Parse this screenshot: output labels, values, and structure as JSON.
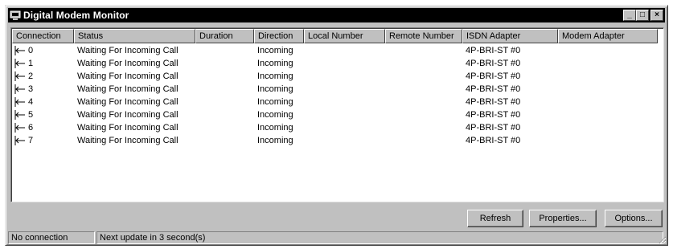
{
  "window": {
    "title": "Digital Modem Monitor",
    "controls": {
      "minimize": "_",
      "maximize": "□",
      "close": "×"
    }
  },
  "table": {
    "columns": [
      "Connection",
      "Status",
      "Duration",
      "Direction",
      "Local Number",
      "Remote Number",
      "ISDN Adapter",
      "Modem Adapter"
    ],
    "rows": [
      {
        "connection": "0",
        "status": "Waiting For Incoming Call",
        "duration": "",
        "direction": "Incoming",
        "local": "",
        "remote": "",
        "isdn": "4P-BRI-ST #0",
        "modem": ""
      },
      {
        "connection": "1",
        "status": "Waiting For Incoming Call",
        "duration": "",
        "direction": "Incoming",
        "local": "",
        "remote": "",
        "isdn": "4P-BRI-ST #0",
        "modem": ""
      },
      {
        "connection": "2",
        "status": "Waiting For Incoming Call",
        "duration": "",
        "direction": "Incoming",
        "local": "",
        "remote": "",
        "isdn": "4P-BRI-ST #0",
        "modem": ""
      },
      {
        "connection": "3",
        "status": "Waiting For Incoming Call",
        "duration": "",
        "direction": "Incoming",
        "local": "",
        "remote": "",
        "isdn": "4P-BRI-ST #0",
        "modem": ""
      },
      {
        "connection": "4",
        "status": "Waiting For Incoming Call",
        "duration": "",
        "direction": "Incoming",
        "local": "",
        "remote": "",
        "isdn": "4P-BRI-ST #0",
        "modem": ""
      },
      {
        "connection": "5",
        "status": "Waiting For Incoming Call",
        "duration": "",
        "direction": "Incoming",
        "local": "",
        "remote": "",
        "isdn": "4P-BRI-ST #0",
        "modem": ""
      },
      {
        "connection": "6",
        "status": "Waiting For Incoming Call",
        "duration": "",
        "direction": "Incoming",
        "local": "",
        "remote": "",
        "isdn": "4P-BRI-ST #0",
        "modem": ""
      },
      {
        "connection": "7",
        "status": "Waiting For Incoming Call",
        "duration": "",
        "direction": "Incoming",
        "local": "",
        "remote": "",
        "isdn": "4P-BRI-ST #0",
        "modem": ""
      }
    ]
  },
  "buttons": {
    "refresh": "Refresh",
    "properties": "Properties...",
    "options": "Options..."
  },
  "statusbar": {
    "connection": "No connection",
    "update": "Next update in 3 second(s)"
  }
}
